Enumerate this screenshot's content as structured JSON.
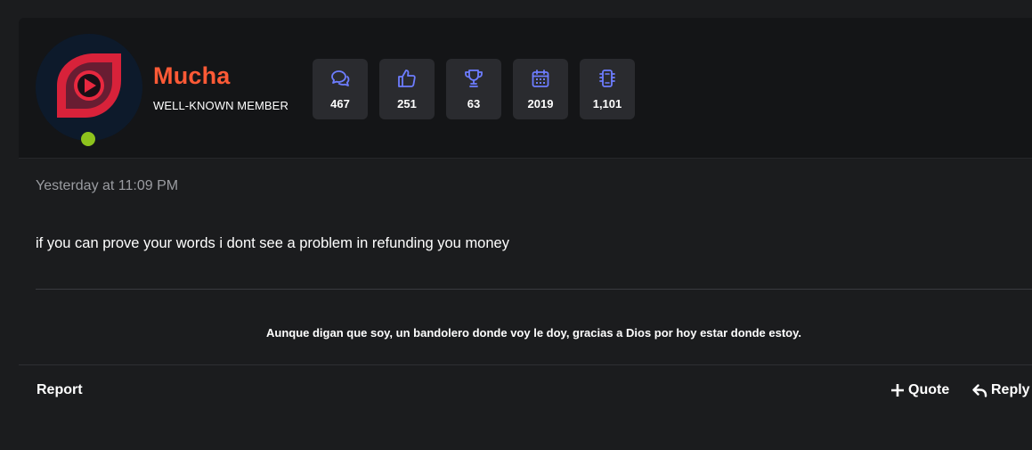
{
  "user": {
    "name": "Mucha",
    "title": "WELL-KNOWN MEMBER",
    "online": true,
    "name_color": "#ff5a36",
    "online_color": "#8dc31d"
  },
  "stats": [
    {
      "icon": "messages-icon",
      "value": "467"
    },
    {
      "icon": "thumbs-up-icon",
      "value": "251"
    },
    {
      "icon": "trophy-icon",
      "value": "63"
    },
    {
      "icon": "calendar-icon",
      "value": "2019"
    },
    {
      "icon": "chip-icon",
      "value": "1,101"
    }
  ],
  "post": {
    "timestamp": "Yesterday at 11:09 PM",
    "message": "if you can prove your words i dont see a problem in refunding you money",
    "signature": "Aunque digan que soy, un bandolero donde voy le doy, gracias a Dios por hoy estar donde estoy."
  },
  "actions": {
    "report": "Report",
    "quote": "Quote",
    "reply": "Reply"
  },
  "colors": {
    "accent_icon": "#6d7dff",
    "background": "#1b1c1e",
    "header_bg": "#141517"
  }
}
